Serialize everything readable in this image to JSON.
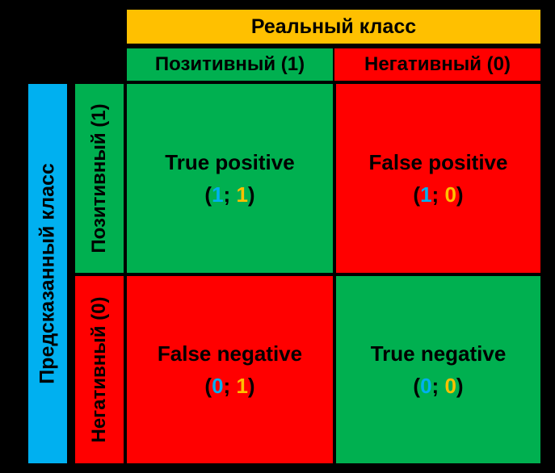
{
  "colors": {
    "background": "#000000",
    "actual_header": "#FFC000",
    "green": "#00B050",
    "red": "#FF0000",
    "predicted_header": "#00B0F0",
    "predicted_digit": "#00B0F0",
    "actual_digit": "#FFC000"
  },
  "actual_header": "Реальный класс",
  "predicted_header": "Предсказанный класс",
  "columns": [
    {
      "label": "Позитивный (1)"
    },
    {
      "label": "Негативный (0)"
    }
  ],
  "rows": [
    {
      "label": "Позитивный (1)"
    },
    {
      "label": "Негативный (0)"
    }
  ],
  "cells": {
    "tp": {
      "title": "True positive",
      "open": "(",
      "predicted": "1",
      "sep": "; ",
      "actual": "1",
      "close": ")"
    },
    "fp": {
      "title": "False positive",
      "open": "(",
      "predicted": "1",
      "sep": "; ",
      "actual": "0",
      "close": ")"
    },
    "fn": {
      "title": "False negative",
      "open": "(",
      "predicted": "0",
      "sep": "; ",
      "actual": "1",
      "close": ")"
    },
    "tn": {
      "title": "True negative",
      "open": "(",
      "predicted": "0",
      "sep": "; ",
      "actual": "0",
      "close": ")"
    }
  }
}
